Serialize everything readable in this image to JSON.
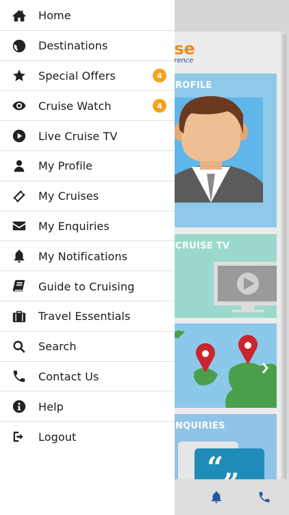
{
  "menu": {
    "items": [
      {
        "label": "Home",
        "icon": "home-icon"
      },
      {
        "label": "Destinations",
        "icon": "globe-icon"
      },
      {
        "label": "Special Offers",
        "icon": "star-icon",
        "badge": "4"
      },
      {
        "label": "Cruise Watch",
        "icon": "eye-icon",
        "badge": "4"
      },
      {
        "label": "Live Cruise TV",
        "icon": "play-icon"
      },
      {
        "label": "My Profile",
        "icon": "user-icon"
      },
      {
        "label": "My Cruises",
        "icon": "ticket-icon"
      },
      {
        "label": "My Enquiries",
        "icon": "envelope-icon"
      },
      {
        "label": "My Notifications",
        "icon": "bell-icon"
      },
      {
        "label": "Guide to Cruising",
        "icon": "book-icon"
      },
      {
        "label": "Travel Essentials",
        "icon": "suitcase-icon"
      },
      {
        "label": "Search",
        "icon": "search-icon"
      },
      {
        "label": "Contact Us",
        "icon": "phone-icon"
      },
      {
        "label": "Help",
        "icon": "info-icon"
      },
      {
        "label": "Logout",
        "icon": "logout-icon"
      }
    ],
    "badge_color": "#f4a31b"
  },
  "background": {
    "logo_main": "ise",
    "logo_sub": "erence",
    "tiles": {
      "profile": "ROFILE",
      "tv": "CRUISE TV",
      "enquiries": "NQUIRIES"
    }
  }
}
